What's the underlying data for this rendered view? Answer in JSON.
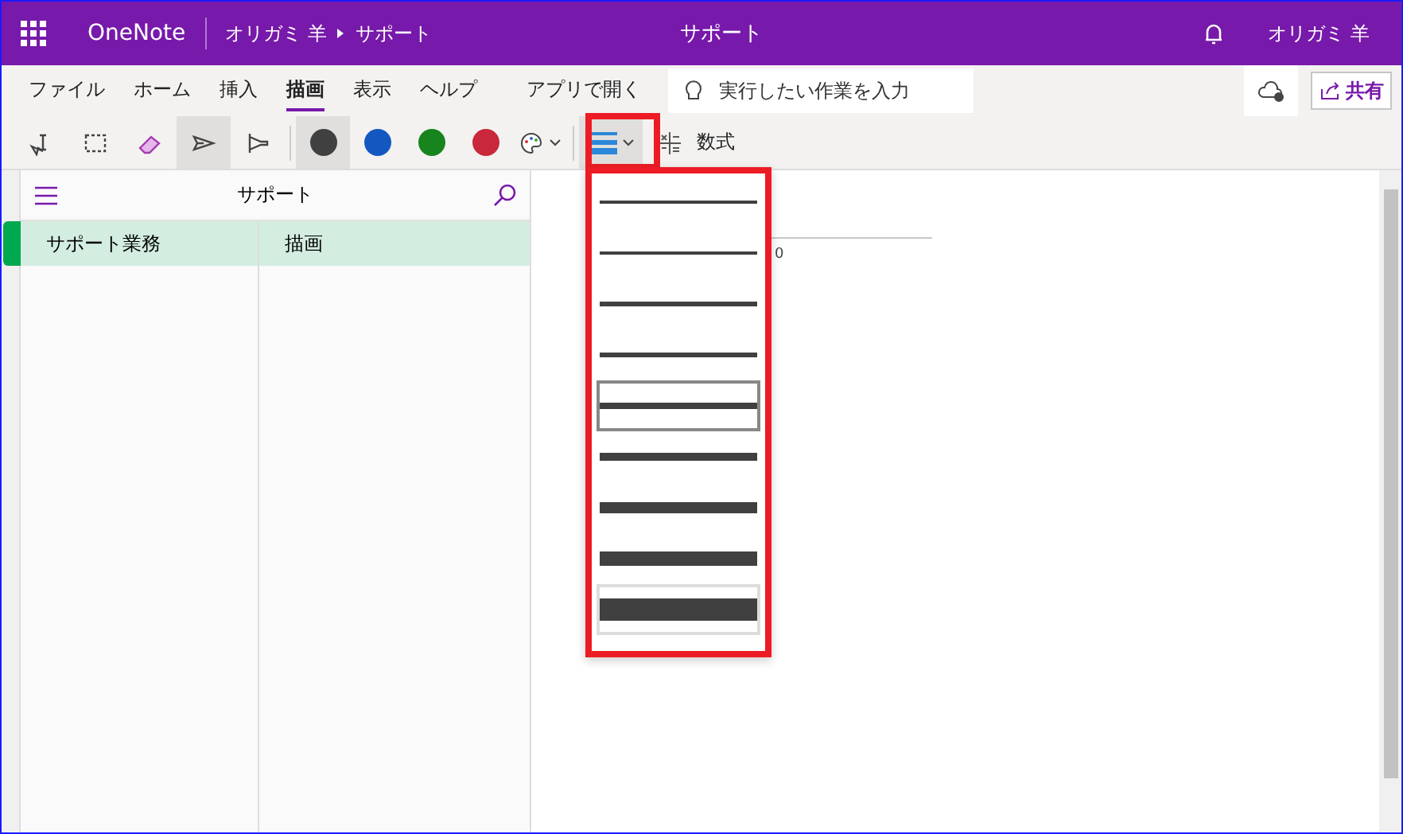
{
  "title_bar": {
    "app": "OneNote",
    "breadcrumb": [
      "オリガミ 羊",
      "サポート"
    ],
    "title": "サポート",
    "user": "オリガミ 羊"
  },
  "ribbon_tabs": [
    {
      "label": "ファイル",
      "selected": false
    },
    {
      "label": "ホーム",
      "selected": false
    },
    {
      "label": "挿入",
      "selected": false
    },
    {
      "label": "描画",
      "selected": true
    },
    {
      "label": "表示",
      "selected": false
    },
    {
      "label": "ヘルプ",
      "selected": false
    },
    {
      "label": "アプリで開く",
      "selected": false
    }
  ],
  "search": {
    "placeholder": "実行したい作業を入力"
  },
  "share_button": "共有",
  "tools": [
    {
      "kind": "lasso",
      "selected": false
    },
    {
      "kind": "select",
      "selected": false
    },
    {
      "kind": "eraser",
      "selected": false
    },
    {
      "kind": "pen",
      "selected": true
    },
    {
      "kind": "highlighter",
      "selected": false
    }
  ],
  "pens": [
    {
      "color": "#404040",
      "selected": true
    },
    {
      "color": "#1258c0",
      "selected": false
    },
    {
      "color": "#17841d",
      "selected": false
    },
    {
      "color": "#c8283a",
      "selected": false
    }
  ],
  "equation_button": "数式",
  "section_header": "サポート",
  "sections": [
    {
      "label": "サポート業務",
      "selected": true,
      "color": "#00a84f"
    }
  ],
  "pages": [
    {
      "label": "描画",
      "selected": true
    }
  ],
  "page_text": "0",
  "thickness_options": [
    {
      "selected": false,
      "hovered": false
    },
    {
      "selected": false,
      "hovered": false
    },
    {
      "selected": false,
      "hovered": false
    },
    {
      "selected": false,
      "hovered": false
    },
    {
      "selected": true,
      "hovered": false
    },
    {
      "selected": false,
      "hovered": false
    },
    {
      "selected": false,
      "hovered": false
    },
    {
      "selected": false,
      "hovered": false
    },
    {
      "selected": false,
      "hovered": true
    }
  ]
}
